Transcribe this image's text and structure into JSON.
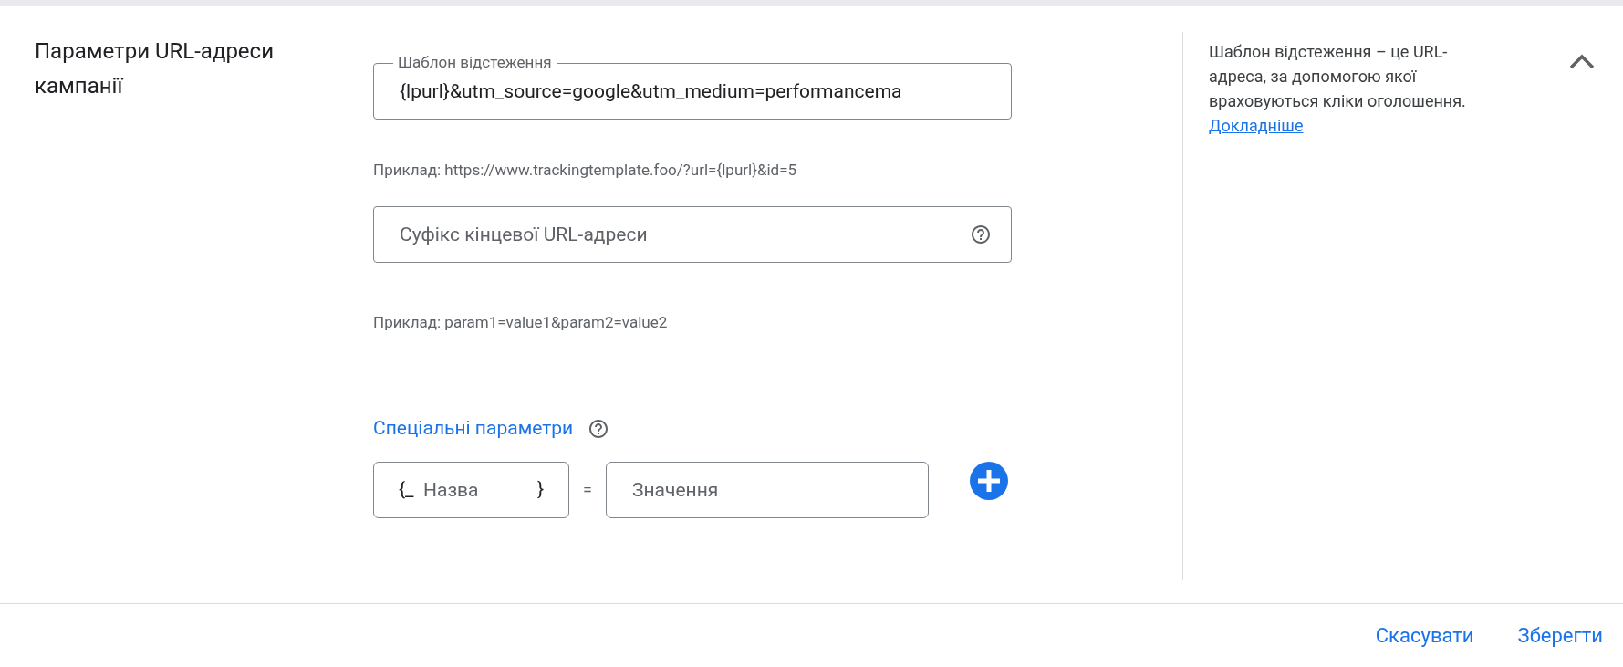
{
  "section": {
    "title": "Параметри URL-адреси кампанії"
  },
  "tracking_template": {
    "label": "Шаблон відстеження",
    "value": "{lpurl}&utm_source=google&utm_medium=performancema",
    "example": "Приклад: https://www.trackingtemplate.foo/?url={lpurl}&id=5"
  },
  "final_url_suffix": {
    "placeholder": "Суфікс кінцевої URL-адреси",
    "example": "Приклад: param1=value1&param2=value2"
  },
  "custom_parameters": {
    "title": "Спеціальні параметри",
    "name_prefix": "{_",
    "name_placeholder": "Назва",
    "name_suffix": "}",
    "equals": "=",
    "value_placeholder": "Значення"
  },
  "help_panel": {
    "text": "Шаблон відстеження – це URL-адреса, за допомогою якої враховуються кліки оголошення.",
    "link": "Докладніше",
    "expanded": true
  },
  "buttons": [
    "Скасувати",
    "Зберегти"
  ]
}
